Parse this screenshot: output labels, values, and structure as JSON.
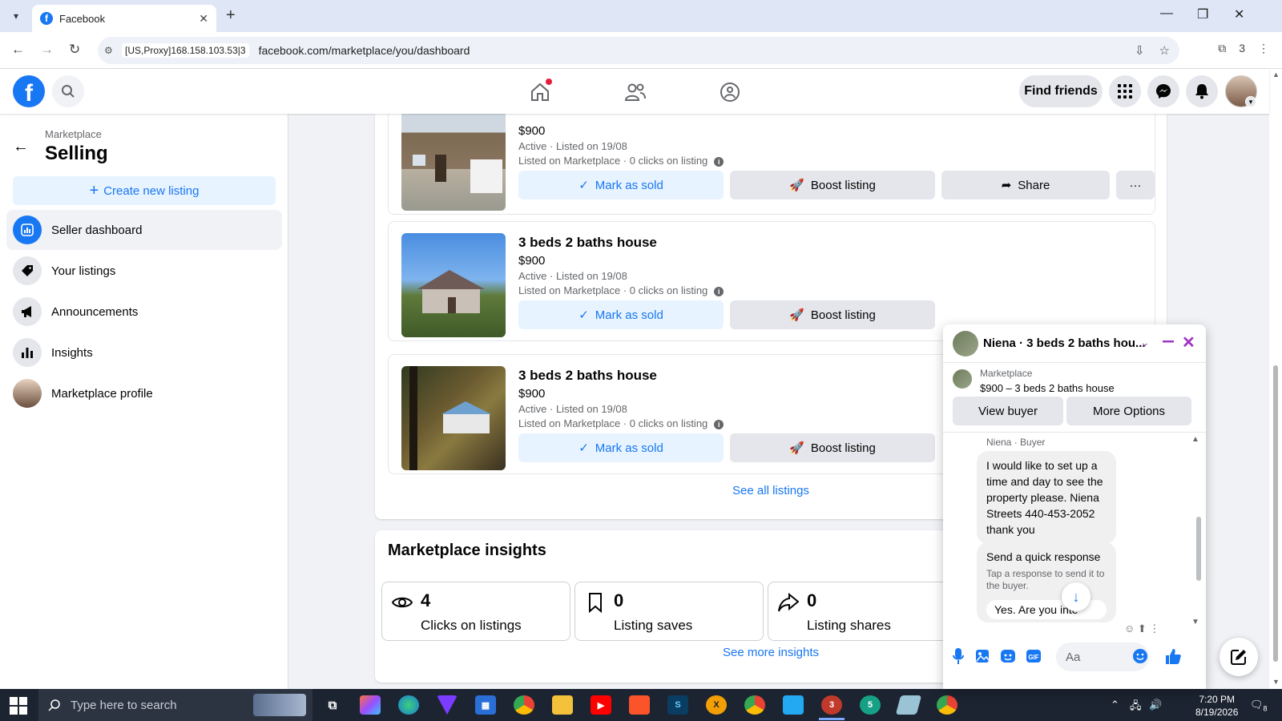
{
  "browser": {
    "tab_title": "Facebook",
    "proxy_label": "[US,Proxy]168.158.103.53|3",
    "url": "facebook.com/marketplace/you/dashboard",
    "ext_count": "3"
  },
  "header": {
    "find_friends": "Find friends"
  },
  "sidebar": {
    "breadcrumb": "Marketplace",
    "title": "Selling",
    "create_label": "Create new listing",
    "items": [
      {
        "label": "Seller dashboard",
        "icon": "chart-icon"
      },
      {
        "label": "Your listings",
        "icon": "tag-icon"
      },
      {
        "label": "Announcements",
        "icon": "megaphone-icon"
      },
      {
        "label": "Insights",
        "icon": "bar-chart-icon"
      },
      {
        "label": "Marketplace profile",
        "icon": "avatar"
      }
    ]
  },
  "listings": [
    {
      "title": "",
      "price": "$900",
      "status": "Active · Listed on 19/08",
      "meta": "Listed on Marketplace · 0 clicks on listing",
      "mark_sold": "Mark as sold",
      "boost": "Boost listing",
      "share": "Share",
      "more": "···"
    },
    {
      "title": "3 beds 2 baths house",
      "price": "$900",
      "status": "Active · Listed on 19/08",
      "meta": "Listed on Marketplace · 0 clicks on listing",
      "mark_sold": "Mark as sold",
      "boost": "Boost listing"
    },
    {
      "title": "3 beds 2 baths house",
      "price": "$900",
      "status": "Active · Listed on 19/08",
      "meta": "Listed on Marketplace · 0 clicks on listing",
      "mark_sold": "Mark as sold",
      "boost": "Boost listing"
    }
  ],
  "see_all": "See all listings",
  "insights": {
    "title": "Marketplace insights",
    "stats": [
      {
        "value": "4",
        "label": "Clicks on listings"
      },
      {
        "value": "0",
        "label": "Listing saves"
      },
      {
        "value": "0",
        "label": "Listing shares"
      }
    ],
    "see_more": "See more insights"
  },
  "chat": {
    "name": "Niena · 3 beds 2 baths hou...",
    "marketplace_label": "Marketplace",
    "item": "$900 – 3 beds 2 baths house",
    "view_buyer": "View buyer",
    "more_options": "More Options",
    "sender": "Niena · Buyer",
    "message": "I would like to set up a time and day to see the property please. Niena Streets 440-453-2052 thank you",
    "quick_title": "Send a quick response",
    "quick_sub": "Tap a response to send it to the buyer.",
    "quick_option": "Yes. Are you inte",
    "input_placeholder": "Aa"
  },
  "taskbar": {
    "search_placeholder": "Type here to search",
    "time": "7:20 PM",
    "date": "8/19/2026",
    "badge_chrome_red": "3",
    "badge_teal": "5",
    "notif_count": "8"
  }
}
